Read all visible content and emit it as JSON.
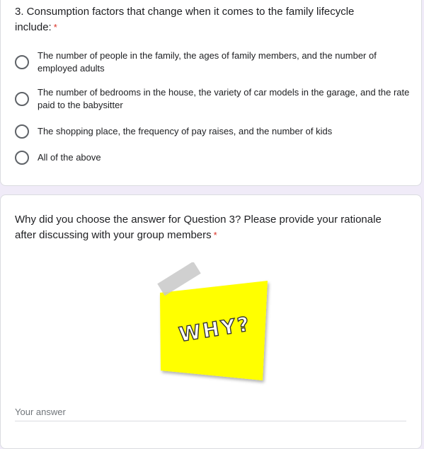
{
  "question3": {
    "title": "3. Consumption factors that change when it comes to the family lifecycle include:",
    "required_mark": "*",
    "options": [
      {
        "label": "The number of people in the family, the ages of family members, and the number of employed adults"
      },
      {
        "label": "The number of bedrooms in the house, the variety of car models in the garage, and the rate paid to the babysitter"
      },
      {
        "label": "The shopping place, the frequency of pay raises, and the number of kids"
      },
      {
        "label": "All of the above"
      }
    ]
  },
  "question4": {
    "title": "Why did you choose the answer for Question 3? Please provide your rationale after discussing with your group members",
    "required_mark": "*",
    "image_text": "WHY?",
    "answer_placeholder": "Your answer"
  },
  "colors": {
    "background": "#f0ebf8",
    "card": "#ffffff",
    "required": "#d93025",
    "sticky_note": "#ffff00",
    "tape": "#c8c8c8"
  }
}
